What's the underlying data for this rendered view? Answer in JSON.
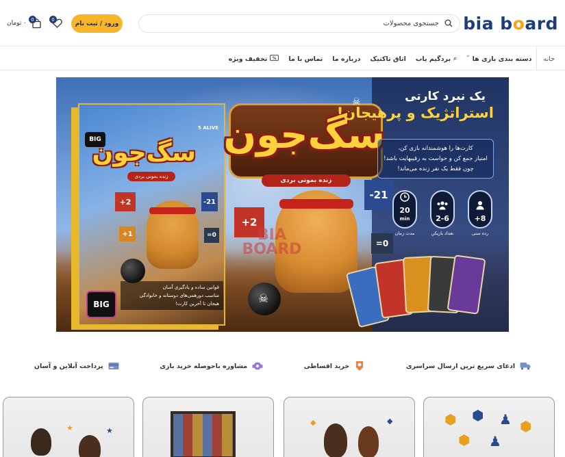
{
  "header": {
    "logo_text_1": "bia b",
    "logo_text_o": "o",
    "logo_text_2": "ard",
    "search_placeholder": "جستجوی محصولات",
    "login_label": "ورود / ثبت نام",
    "wishlist_count": "0",
    "cart_count": "0",
    "cart_total": "۰ تومان"
  },
  "nav": {
    "items": [
      {
        "label": "خانه"
      },
      {
        "label": "دسته بندی بازی ها"
      },
      {
        "label": "بردگیم یاب"
      },
      {
        "label": "اتاق تاکتیک"
      },
      {
        "label": "درباره ما"
      },
      {
        "label": "تماس با ما"
      },
      {
        "label": "تخفیف ویژه"
      }
    ]
  },
  "banner": {
    "tagline_1": "یک نبرد کارتی",
    "tagline_2": "استراتژیک و پرهیجان!",
    "description_line_1": "کارت‌ها را هوشمندانه بازی کن،",
    "description_line_2": "امتیاز جمع کن و حواست به رقیبهایت باشد!",
    "description_line_3": "چون فقط یک نفر زنده می‌ماند!",
    "game_title": "سگ‌جون",
    "game_subtitle": "زنده بمونی بردی",
    "stats": [
      {
        "value": "8+",
        "label": "رده سنی"
      },
      {
        "value": "2-6",
        "label": "تعداد بازیکن"
      },
      {
        "value": "20",
        "unit": "min",
        "label": "مدت زمان"
      }
    ],
    "box_alive": "5 ALIVE",
    "box_features": [
      "قوانین ساده و یادگیری آسان",
      "مناسب دورهمی‌های دوستانه و خانوادگی",
      "هیجان تا آخرین کارت!"
    ],
    "publisher": "BIG",
    "flags": [
      "+2",
      "-21",
      "+1",
      "=0",
      "+2",
      "-21",
      "=0"
    ]
  },
  "features": [
    {
      "label": "ادعای سریع ترین ارسال سراسری",
      "icon": "truck-icon",
      "color": "#7a90c8"
    },
    {
      "label": "خرید اقساطی",
      "icon": "hand-coin-icon",
      "color": "#e8804a"
    },
    {
      "label": "مشاوره باحوصله خرید بازی",
      "icon": "headset-icon",
      "color": "#9a7ad8"
    },
    {
      "label": "پرداخت آنلاین و آسان",
      "icon": "card-icon",
      "color": "#7a90c8"
    }
  ],
  "colors": {
    "brand_blue": "#1d3c78",
    "accent_yellow": "#f7b52b"
  }
}
